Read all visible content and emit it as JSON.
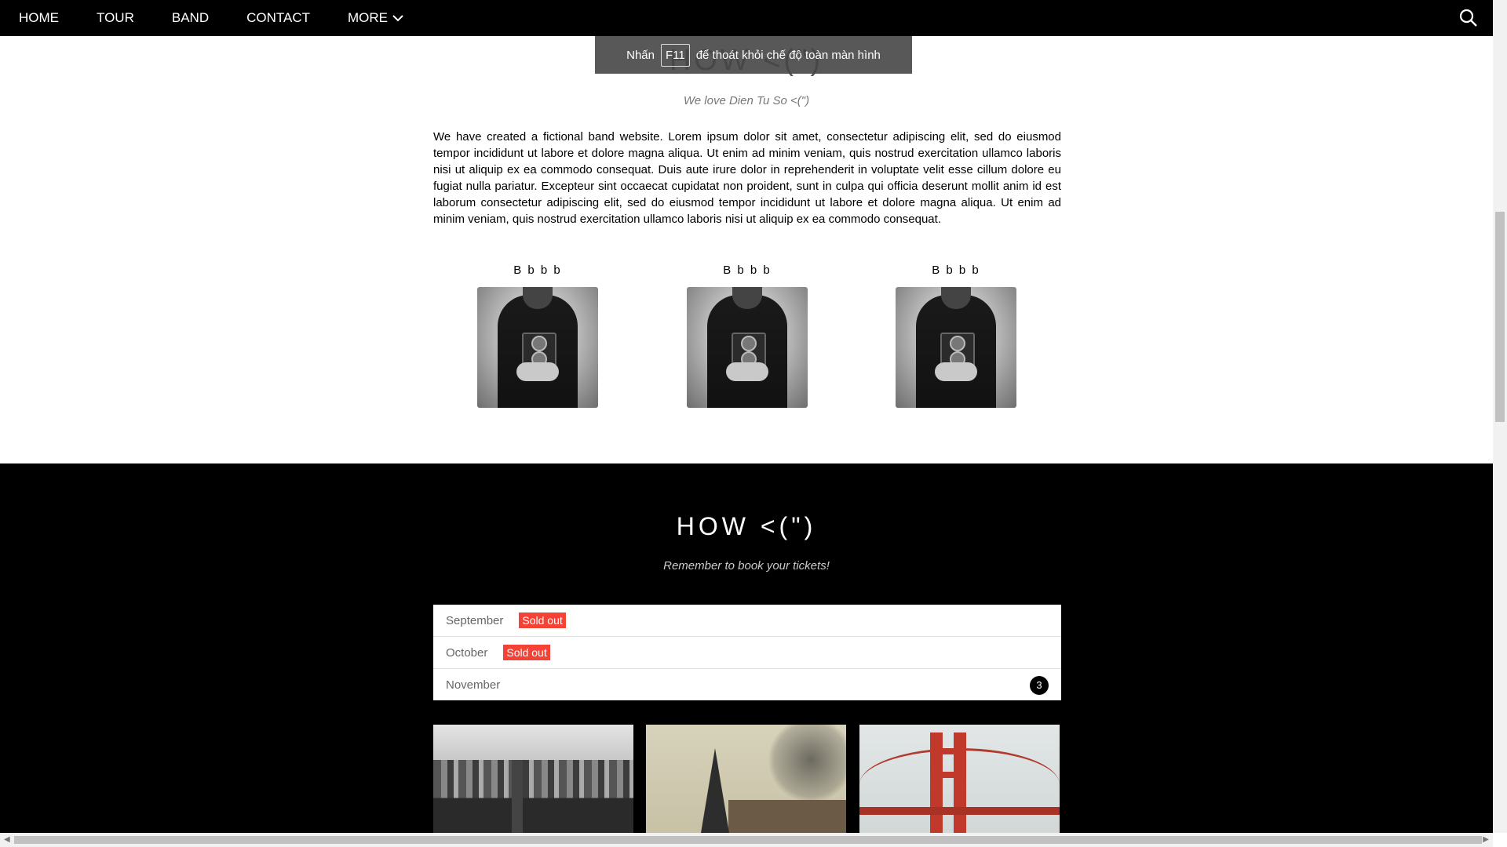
{
  "nav": {
    "items": [
      "HOME",
      "TOUR",
      "BAND",
      "CONTACT",
      "MORE"
    ]
  },
  "toast": {
    "prefix": "Nhấn",
    "key": "F11",
    "suffix": "để thoát khỏi chế độ toàn màn hình"
  },
  "band": {
    "title_partial": "HOW <(\")",
    "tagline": "We love Dien Tu So <(\")",
    "about": "We have created a fictional band website. Lorem ipsum dolor sit amet, consectetur adipiscing elit, sed do eiusmod tempor incididunt ut labore et dolore magna aliqua. Ut enim ad minim veniam, quis nostrud exercitation ullamco laboris nisi ut aliquip ex ea commodo consequat. Duis aute irure dolor in reprehenderit in voluptate velit esse cillum dolore eu fugiat nulla pariatur. Excepteur sint occaecat cupidatat non proident, sunt in culpa qui officia deserunt mollit anim id est laborum consectetur adipiscing elit, sed do eiusmod tempor incididunt ut labore et dolore magna aliqua. Ut enim ad minim veniam, quis nostrud exercitation ullamco laboris nisi ut aliquip ex ea commodo consequat.",
    "members": [
      {
        "name": "B b b b"
      },
      {
        "name": "B b b b"
      },
      {
        "name": "B b b b"
      }
    ]
  },
  "tour": {
    "title": "HOW <(\")",
    "subtitle": "Remember to book your tickets!",
    "months": [
      {
        "month": "September",
        "badge": "Sold out"
      },
      {
        "month": "October",
        "badge": "Sold out"
      },
      {
        "month": "November",
        "count": "3"
      }
    ]
  },
  "colors": {
    "accent_red": "#f44336",
    "nav_bg": "#000000"
  }
}
